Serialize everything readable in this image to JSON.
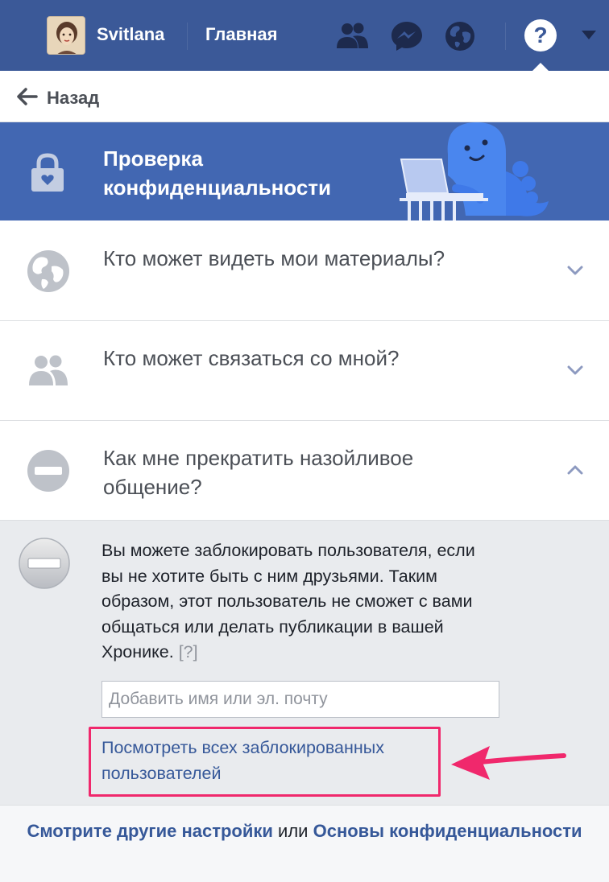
{
  "topbar": {
    "username": "Svitlana",
    "home_label": "Главная",
    "help_label": "?",
    "bg_color": "#3b5998"
  },
  "back": {
    "label": "Назад"
  },
  "banner": {
    "title": "Проверка конфиденциальности",
    "bg_color": "#4267b2"
  },
  "sections": [
    {
      "title": "Кто может видеть мои материалы?",
      "icon": "globe-icon",
      "expanded": false
    },
    {
      "title": "Кто может связаться со мной?",
      "icon": "people-icon",
      "expanded": false
    },
    {
      "title": "Как мне прекратить назойливое общение?",
      "icon": "block-icon",
      "expanded": true
    }
  ],
  "panel": {
    "description": "Вы можете заблокировать пользователя, если вы не хотите быть с ним друзьями. Таким образом, этот пользователь не сможет с вами общаться или делать публикации в вашей Хронике.",
    "help_marker": "[?]",
    "input_placeholder": "Добавить имя или эл. почту",
    "blocked_link": "Посмотреть всех заблокированных пользователей",
    "highlight_color": "#f0286c"
  },
  "footer": {
    "link1": "Смотрите другие настройки",
    "connector": "или",
    "link2": "Основы конфиденциальности"
  }
}
